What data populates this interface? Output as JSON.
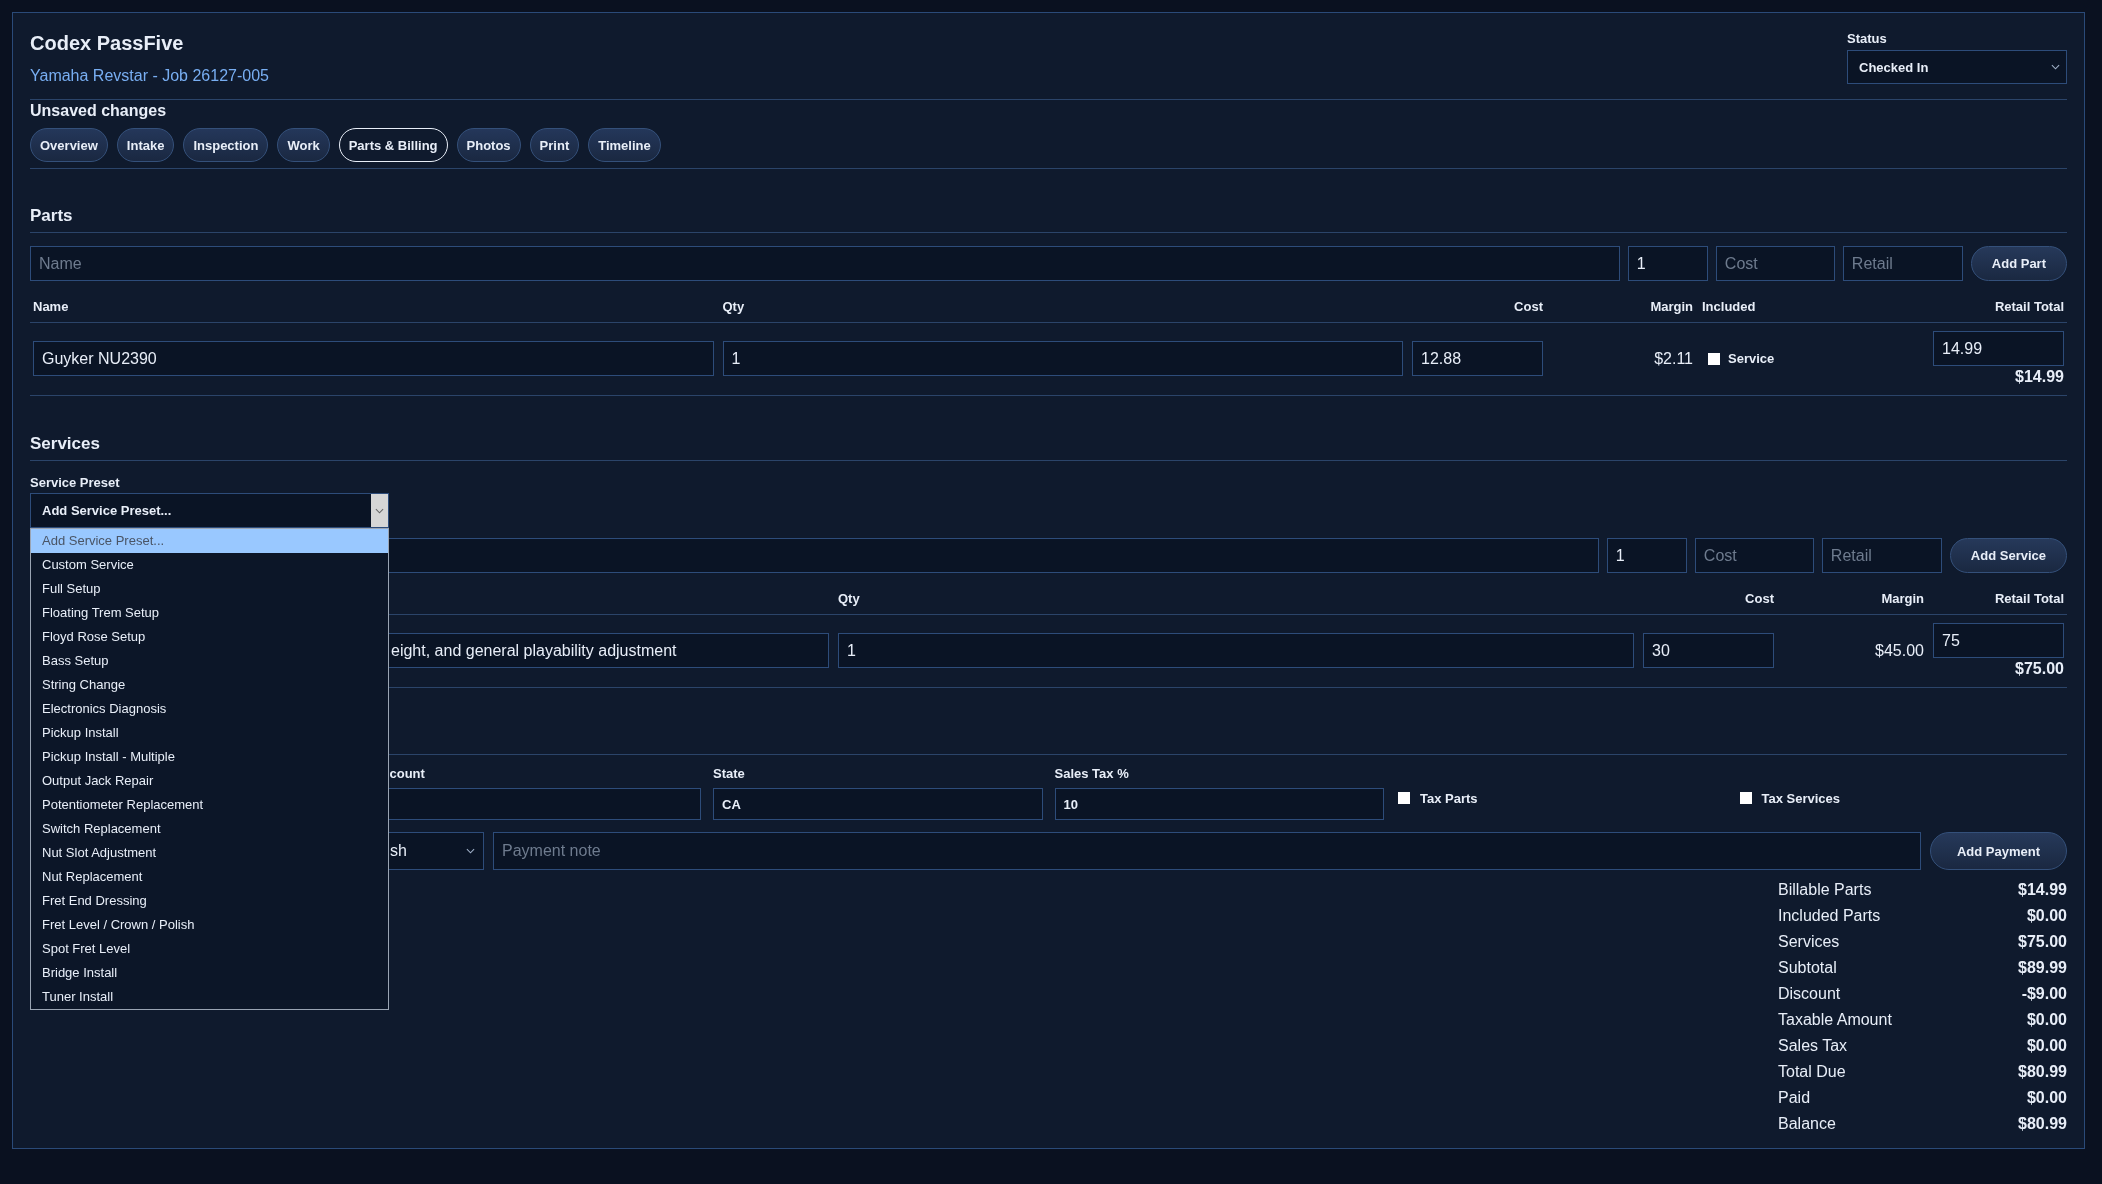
{
  "app": {
    "title": "Codex PassFive",
    "subtitle": "Yamaha Revstar - Job 26127-005",
    "notice": "Unsaved changes"
  },
  "status": {
    "label": "Status",
    "value": "Checked In"
  },
  "tabs": [
    {
      "label": "Overview",
      "selected": false
    },
    {
      "label": "Intake",
      "selected": false
    },
    {
      "label": "Inspection",
      "selected": false
    },
    {
      "label": "Work",
      "selected": false
    },
    {
      "label": "Parts & Billing",
      "selected": true
    },
    {
      "label": "Photos",
      "selected": false
    },
    {
      "label": "Print",
      "selected": false
    },
    {
      "label": "Timeline",
      "selected": false
    }
  ],
  "parts": {
    "heading": "Parts",
    "new": {
      "name_placeholder": "Name",
      "qty": "1",
      "cost_placeholder": "Cost",
      "retail_placeholder": "Retail",
      "button": "Add Part"
    },
    "columns": [
      "Name",
      "Qty",
      "Cost",
      "Margin",
      "Included",
      "Retail Total"
    ],
    "rows": [
      {
        "name": "Guyker NU2390",
        "qty": "1",
        "cost": "12.88",
        "margin": "$2.11",
        "included": false,
        "included_label": "Service",
        "retail": "14.99",
        "total": "$14.99"
      }
    ]
  },
  "services": {
    "heading": "Services",
    "preset": {
      "label": "Service Preset",
      "value": "Add Service Preset...",
      "options": [
        {
          "label": "Add Service Preset...",
          "selected": true
        },
        {
          "label": "Custom Service",
          "selected": false
        },
        {
          "label": "Full Setup",
          "selected": false
        },
        {
          "label": "Floating Trem Setup",
          "selected": false
        },
        {
          "label": "Floyd Rose Setup",
          "selected": false
        },
        {
          "label": "Bass Setup",
          "selected": false
        },
        {
          "label": "String Change",
          "selected": false
        },
        {
          "label": "Electronics Diagnosis",
          "selected": false
        },
        {
          "label": "Pickup Install",
          "selected": false
        },
        {
          "label": "Pickup Install - Multiple",
          "selected": false
        },
        {
          "label": "Output Jack Repair",
          "selected": false
        },
        {
          "label": "Potentiometer Replacement",
          "selected": false
        },
        {
          "label": "Switch Replacement",
          "selected": false
        },
        {
          "label": "Nut Slot Adjustment",
          "selected": false
        },
        {
          "label": "Nut Replacement",
          "selected": false
        },
        {
          "label": "Fret End Dressing",
          "selected": false
        },
        {
          "label": "Fret Level / Crown / Polish",
          "selected": false
        },
        {
          "label": "Spot Fret Level",
          "selected": false
        },
        {
          "label": "Bridge Install",
          "selected": false
        },
        {
          "label": "Tuner Install",
          "selected": false
        }
      ]
    },
    "new": {
      "qty": "1",
      "cost_placeholder": "Cost",
      "retail_placeholder": "Retail",
      "button": "Add Service"
    },
    "columns": [
      "Qty",
      "Cost",
      "Margin",
      "Retail Total"
    ],
    "rows": [
      {
        "description": "eight, and general playability adjustment",
        "qty": "1",
        "cost": "30",
        "margin": "$45.00",
        "retail": "75",
        "total": "$75.00"
      }
    ]
  },
  "billing": {
    "discount_label": "count",
    "state": {
      "label": "State",
      "value": "CA"
    },
    "sales_tax": {
      "label": "Sales Tax %",
      "value": "10"
    },
    "toggles": [
      {
        "label": "Tax Parts",
        "checked": false
      },
      {
        "label": "Tax Services",
        "checked": false
      }
    ],
    "payment": {
      "method": "sh",
      "note_placeholder": "Payment note",
      "button": "Add Payment"
    }
  },
  "totals": [
    {
      "label": "Billable Parts",
      "value": "$14.99"
    },
    {
      "label": "Included Parts",
      "value": "$0.00"
    },
    {
      "label": "Services",
      "value": "$75.00"
    },
    {
      "label": "Subtotal",
      "value": "$89.99"
    },
    {
      "label": "Discount",
      "value": "-$9.00"
    },
    {
      "label": "Taxable Amount",
      "value": "$0.00"
    },
    {
      "label": "Sales Tax",
      "value": "$0.00"
    },
    {
      "label": "Total Due",
      "value": "$80.99"
    },
    {
      "label": "Paid",
      "value": "$0.00"
    },
    {
      "label": "Balance",
      "value": "$80.99"
    }
  ]
}
